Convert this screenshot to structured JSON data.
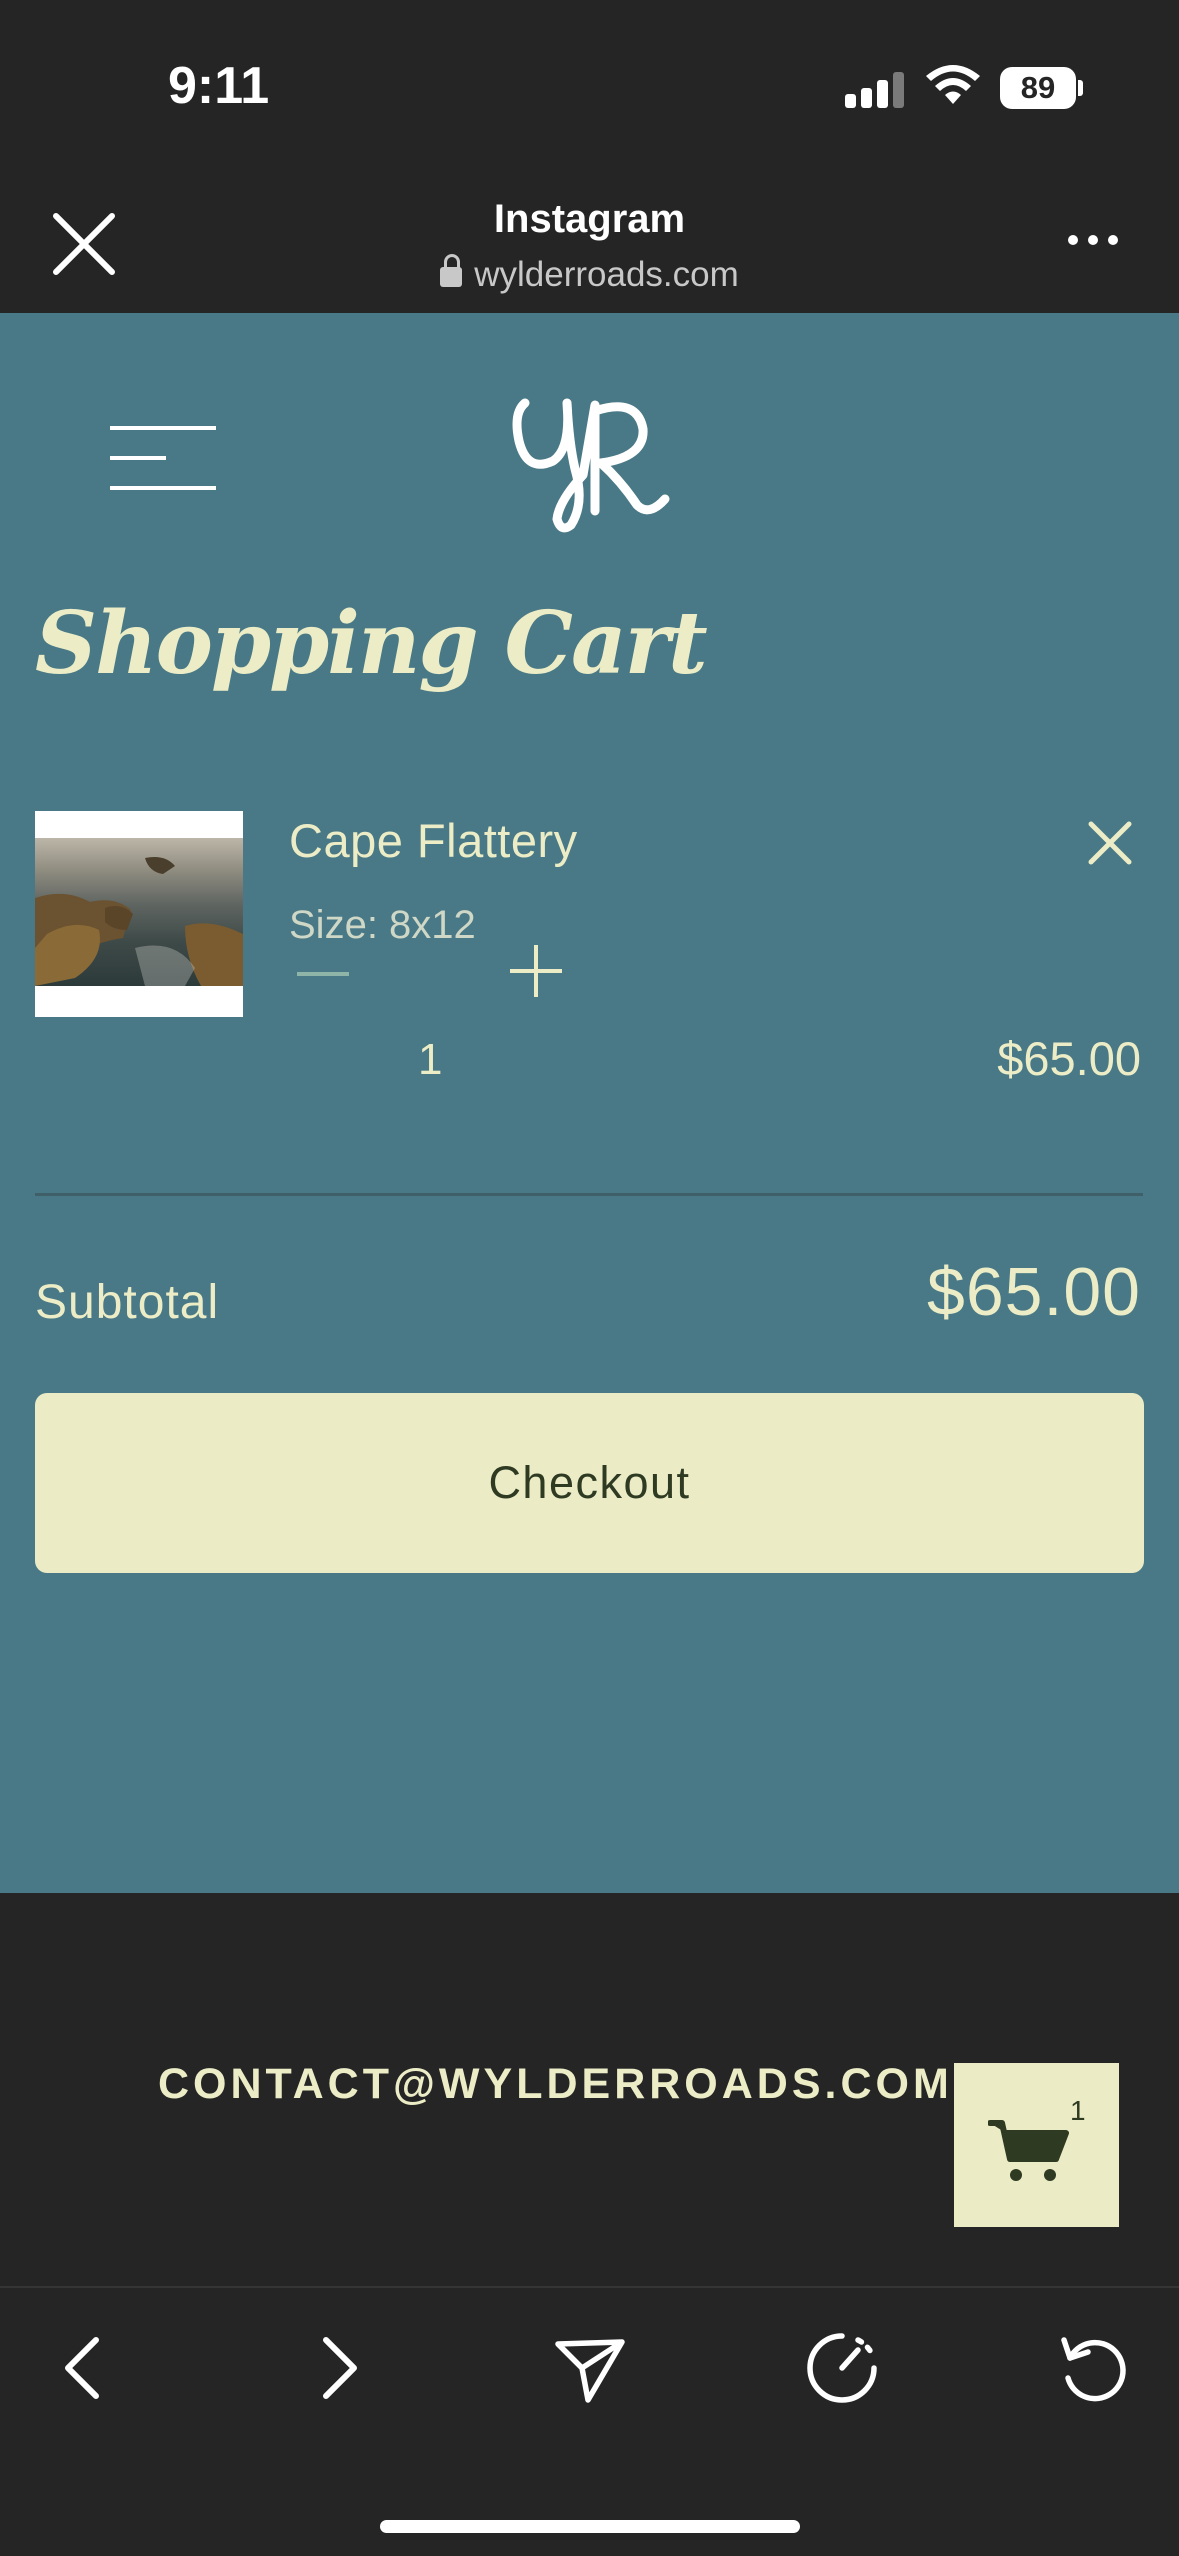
{
  "status_bar": {
    "time": "9:11",
    "battery": "89"
  },
  "browser": {
    "title": "Instagram",
    "url": "wylderroads.com"
  },
  "site": {
    "page_title": "Shopping Cart",
    "item": {
      "name": "Cape Flattery",
      "size": "Size: 8x12",
      "quantity": "1",
      "price": "$65.00"
    },
    "subtotal_label": "Subtotal",
    "subtotal_value": "$65.00",
    "checkout_label": "Checkout"
  },
  "footer": {
    "contact": "CONTACT@WYLDERROADS.COM",
    "cart_count": "1"
  },
  "colors": {
    "site_bg": "#497986",
    "cream": "#ecedc6",
    "dark": "#252525",
    "button_text": "#2e3a22"
  }
}
